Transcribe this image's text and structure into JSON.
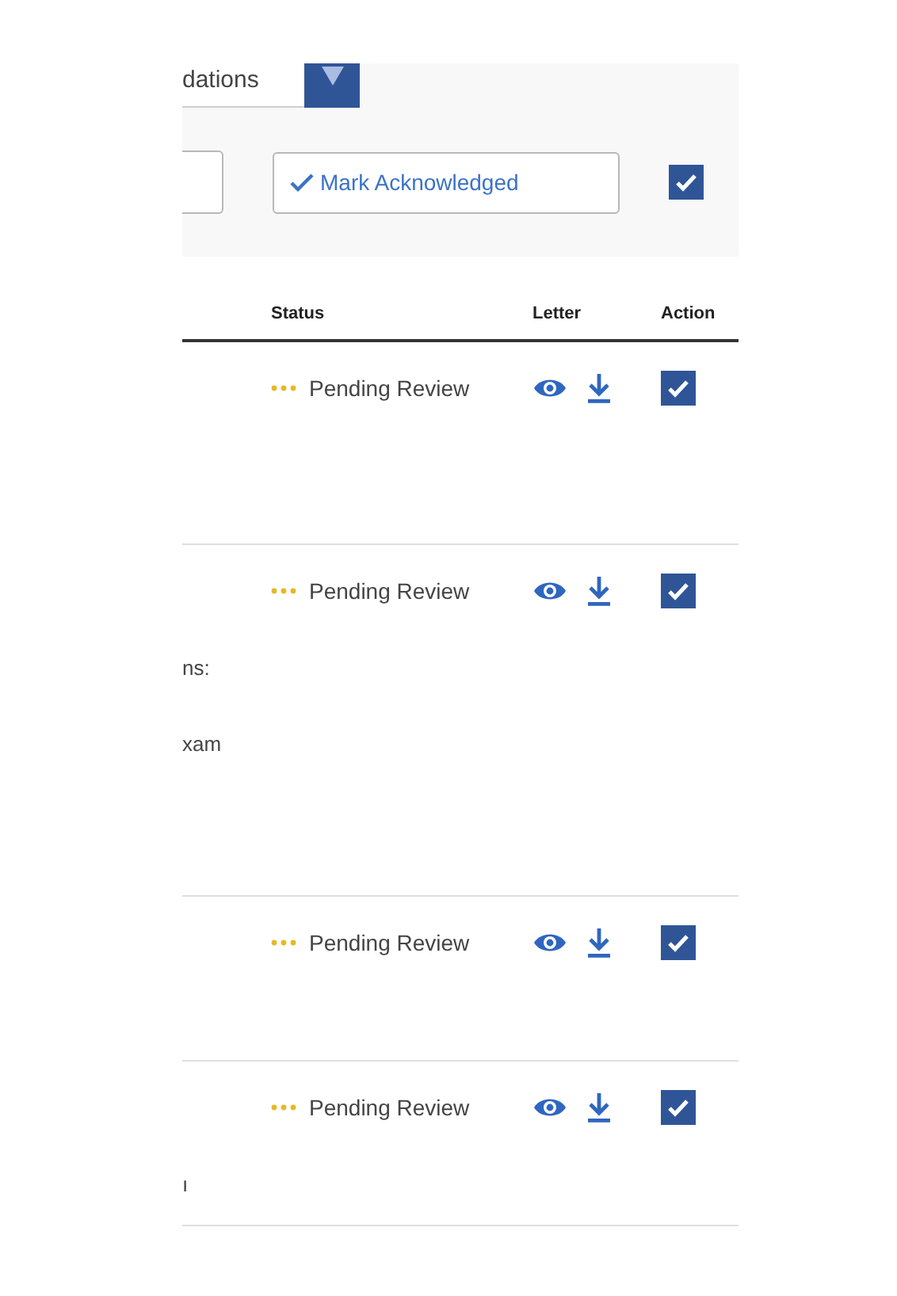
{
  "filter": {
    "dropdown_value": "dations"
  },
  "toolbar": {
    "mark_button": "Mark Acknowledged",
    "select_all": {
      "checked": true
    }
  },
  "table": {
    "columns": [
      "Status",
      "Letter",
      "Action"
    ],
    "rows": [
      {
        "status": "Pending Review",
        "lines": [],
        "checked": true
      },
      {
        "status": "Pending Review",
        "lines": [
          "ns:",
          "xam"
        ],
        "checked": true
      },
      {
        "status": "Pending Review",
        "lines": [],
        "checked": true
      },
      {
        "status": "Pending Review",
        "lines": [
          "ı"
        ],
        "checked": true
      }
    ]
  }
}
